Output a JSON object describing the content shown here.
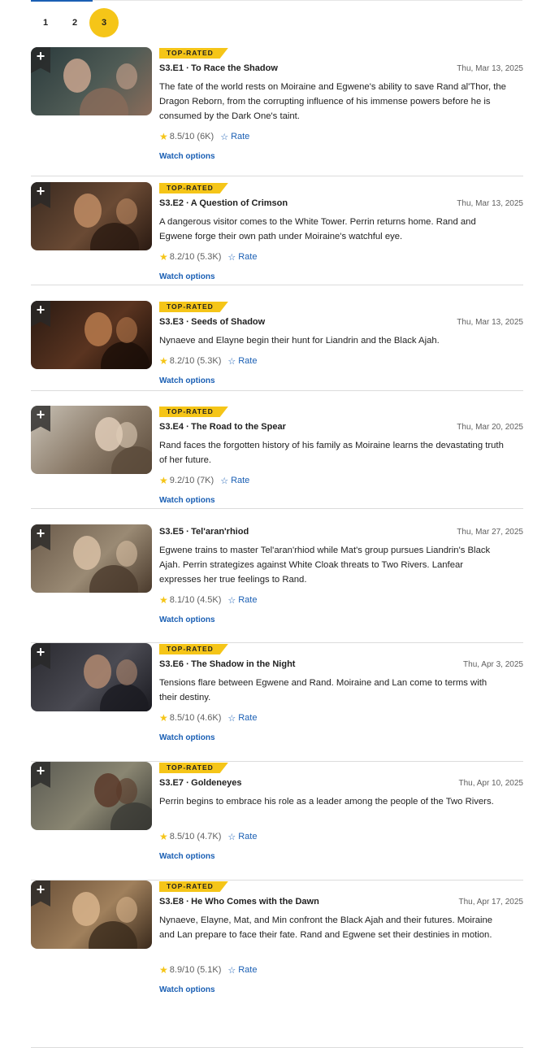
{
  "pagination": {
    "pages": [
      "1",
      "2",
      "3"
    ],
    "active_index": 2
  },
  "add_symbol": "+",
  "badge_label": "TOP-RATED",
  "rate_label": "Rate",
  "watch_label": "Watch options",
  "episodes": [
    {
      "code_title": "S3.E1 ∙ To Race the Shadow",
      "date": "Thu, Mar 13, 2025",
      "description": "The fate of the world rests on Moiraine and Egwene's ability to save Rand al'Thor, the Dragon Reborn, from the corrupting influence of his immense powers before he is consumed by the Dark One's taint.",
      "rating": "8.5/10 (6K)",
      "top_rated": true
    },
    {
      "code_title": "S3.E2 ∙ A Question of Crimson",
      "date": "Thu, Mar 13, 2025",
      "description": "A dangerous visitor comes to the White Tower. Perrin returns home. Rand and Egwene forge their own path under Moiraine's watchful eye.",
      "rating": "8.2/10 (5.3K)",
      "top_rated": true
    },
    {
      "code_title": "S3.E3 ∙ Seeds of Shadow",
      "date": "Thu, Mar 13, 2025",
      "description": "Nynaeve and Elayne begin their hunt for Liandrin and the Black Ajah.",
      "rating": "8.2/10 (5.3K)",
      "top_rated": true
    },
    {
      "code_title": "S3.E4 ∙ The Road to the Spear",
      "date": "Thu, Mar 20, 2025",
      "description": "Rand faces the forgotten history of his family as Moiraine learns the devastating truth of her future.",
      "rating": "9.2/10 (7K)",
      "top_rated": true
    },
    {
      "code_title": "S3.E5 ∙ Tel'aran'rhiod",
      "date": "Thu, Mar 27, 2025",
      "description": "Egwene trains to master Tel'aran'rhiod while Mat's group pursues Liandrin's Black Ajah. Perrin strategizes against White Cloak threats to Two Rivers. Lanfear expresses her true feelings to Rand.",
      "rating": "8.1/10 (4.5K)",
      "top_rated": false
    },
    {
      "code_title": "S3.E6 ∙ The Shadow in the Night",
      "date": "Thu, Apr 3, 2025",
      "description": "Tensions flare between Egwene and Rand. Moiraine and Lan come to terms with their destiny.",
      "rating": "8.5/10 (4.6K)",
      "top_rated": true
    },
    {
      "code_title": "S3.E7 ∙ Goldeneyes",
      "date": "Thu, Apr 10, 2025",
      "description": "Perrin begins to embrace his role as a leader among the people of the Two Rivers.",
      "rating": "8.5/10 (4.7K)",
      "top_rated": true
    },
    {
      "code_title": "S3.E8 ∙ He Who Comes with the Dawn",
      "date": "Thu, Apr 17, 2025",
      "description": "Nynaeve, Elayne, Mat, and Min confront the Black Ajah and their futures. Moiraine and Lan prepare to face their fate. Rand and Egwene set their destinies in motion.",
      "rating": "8.9/10 (5.1K)",
      "top_rated": true
    }
  ],
  "colors": {
    "accent": "#f5c518",
    "link": "#1a5fb4"
  }
}
